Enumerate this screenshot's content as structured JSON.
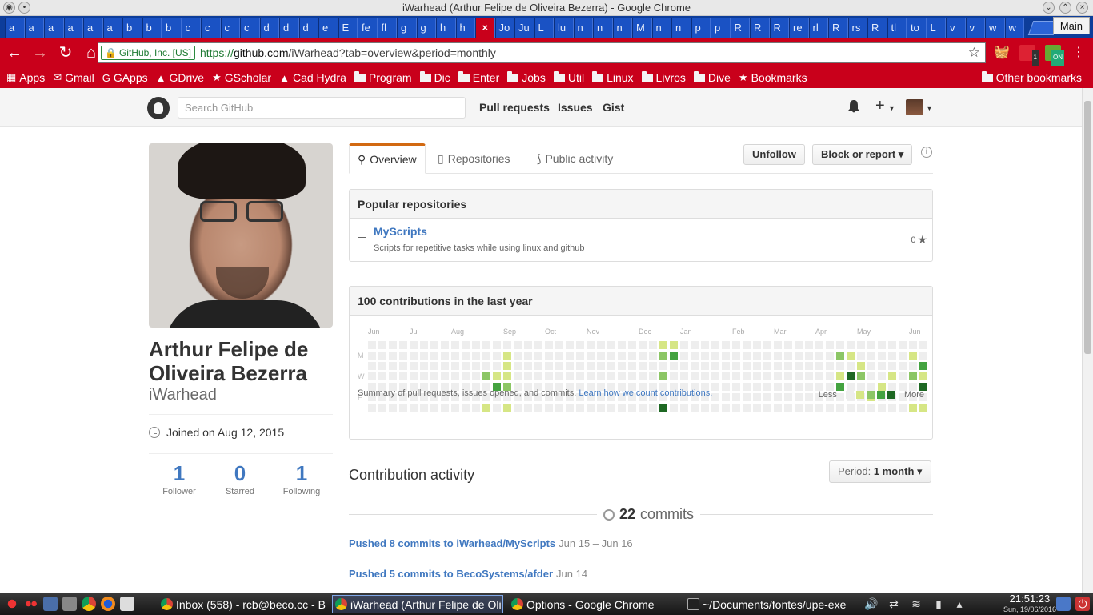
{
  "window": {
    "title": "iWarhead (Arthur Felipe de Oliveira Bezerra) - Google Chrome"
  },
  "tabs": {
    "labels": [
      "a",
      "a",
      "a",
      "a",
      "a",
      "a",
      "b",
      "b",
      "b",
      "c",
      "c",
      "c",
      "c",
      "d",
      "d",
      "d",
      "e",
      "E",
      "fe",
      "fl",
      "g",
      "g",
      "h",
      "h",
      "×",
      "Jo",
      "Ju",
      "L",
      "lu",
      "n",
      "n",
      "n",
      "M",
      "n",
      "n",
      "p",
      "p",
      "R",
      "R",
      "R",
      "re",
      "rl",
      "R",
      "rs",
      "R",
      "tl",
      "to",
      "L",
      "v",
      "v",
      "w",
      "w"
    ],
    "active_index": 24,
    "profile": "Main"
  },
  "toolbar": {
    "ev_badge": "GitHub, Inc. [US]",
    "url_scheme": "https://",
    "url_host": "github.com",
    "url_path": "/iWarhead?tab=overview&period=monthly",
    "ext_badge_1": "1",
    "ext_badge_2": "ON"
  },
  "bookmarks": {
    "items": [
      "Apps",
      "Gmail",
      "GApps",
      "GDrive",
      "GScholar",
      "Cad Hydra",
      "Program",
      "Dic",
      "Enter",
      "Jobs",
      "Util",
      "Linux",
      "Livros",
      "Dive",
      "Bookmarks"
    ],
    "other": "Other bookmarks"
  },
  "github": {
    "search_placeholder": "Search GitHub",
    "nav": [
      "Pull requests",
      "Issues",
      "Gist"
    ]
  },
  "profile": {
    "full_name": "Arthur Felipe de Oliveira Bezerra",
    "username": "iWarhead",
    "joined": "Joined on Aug 12, 2015",
    "stats": [
      {
        "num": "1",
        "label": "Follower"
      },
      {
        "num": "0",
        "label": "Starred"
      },
      {
        "num": "1",
        "label": "Following"
      }
    ]
  },
  "profile_tabs": {
    "overview": "Overview",
    "repositories": "Repositories",
    "activity": "Public activity"
  },
  "actions": {
    "unfollow": "Unfollow",
    "block": "Block or report"
  },
  "popular": {
    "heading": "Popular repositories",
    "repo_name": "MyScripts",
    "repo_desc": "Scripts for repetitive tasks while using linux and github",
    "stars": "0"
  },
  "contributions": {
    "heading": "100 contributions in the last year",
    "months": [
      "Jun",
      "Jul",
      "Aug",
      "Sep",
      "Oct",
      "Nov",
      "Dec",
      "Jan",
      "Feb",
      "Mar",
      "Apr",
      "May",
      "Jun"
    ],
    "day_labels": [
      "M",
      "W",
      "F"
    ],
    "summary": "Summary of pull requests, issues opened, and commits.",
    "learn_link": "Learn how we count contributions.",
    "less": "Less",
    "more": "More",
    "levels": [
      "#eeeeee",
      "#d6e685",
      "#8cc665",
      "#44a340",
      "#1e6823"
    ],
    "active_cells": [
      [
        28,
        0,
        1
      ],
      [
        29,
        0,
        1
      ],
      [
        28,
        1,
        2
      ],
      [
        29,
        1,
        3
      ],
      [
        13,
        1,
        1
      ],
      [
        13,
        2,
        1
      ],
      [
        13,
        3,
        1
      ],
      [
        13,
        4,
        2
      ],
      [
        13,
        6,
        1
      ],
      [
        12,
        3,
        1
      ],
      [
        12,
        4,
        3
      ],
      [
        11,
        3,
        2
      ],
      [
        11,
        6,
        1
      ],
      [
        28,
        3,
        2
      ],
      [
        28,
        6,
        4
      ],
      [
        45,
        1,
        2
      ],
      [
        46,
        1,
        1
      ],
      [
        45,
        3,
        1
      ],
      [
        46,
        3,
        4
      ],
      [
        45,
        4,
        3
      ],
      [
        47,
        2,
        1
      ],
      [
        47,
        3,
        2
      ],
      [
        48,
        5,
        1
      ],
      [
        50,
        3,
        1
      ],
      [
        49,
        4,
        1
      ],
      [
        52,
        1,
        1
      ],
      [
        53,
        2,
        3
      ],
      [
        52,
        3,
        2
      ],
      [
        53,
        3,
        1
      ],
      [
        53,
        4,
        4
      ],
      [
        52,
        6,
        1
      ],
      [
        53,
        6,
        1
      ]
    ]
  },
  "activity": {
    "title": "Contribution activity",
    "period_label": "Period:",
    "period_value": "1 month",
    "commits_count": "22",
    "commits_word": "commits",
    "pushes": [
      {
        "link": "Pushed 8 commits to iWarhead/MyScripts",
        "date": "Jun 15 – Jun 16"
      },
      {
        "link": "Pushed 5 commits to BecoSystems/afder",
        "date": "Jun 14"
      }
    ]
  },
  "taskbar": {
    "tasks": [
      "Inbox (558) - rcb@beco.cc - B",
      "iWarhead (Arthur Felipe de Oli",
      "Options - Google Chrome",
      "~/Documents/fontes/upe-exe"
    ],
    "active_task": 1,
    "time": "21:51:23",
    "date": "Sun, 19/06/2016"
  }
}
